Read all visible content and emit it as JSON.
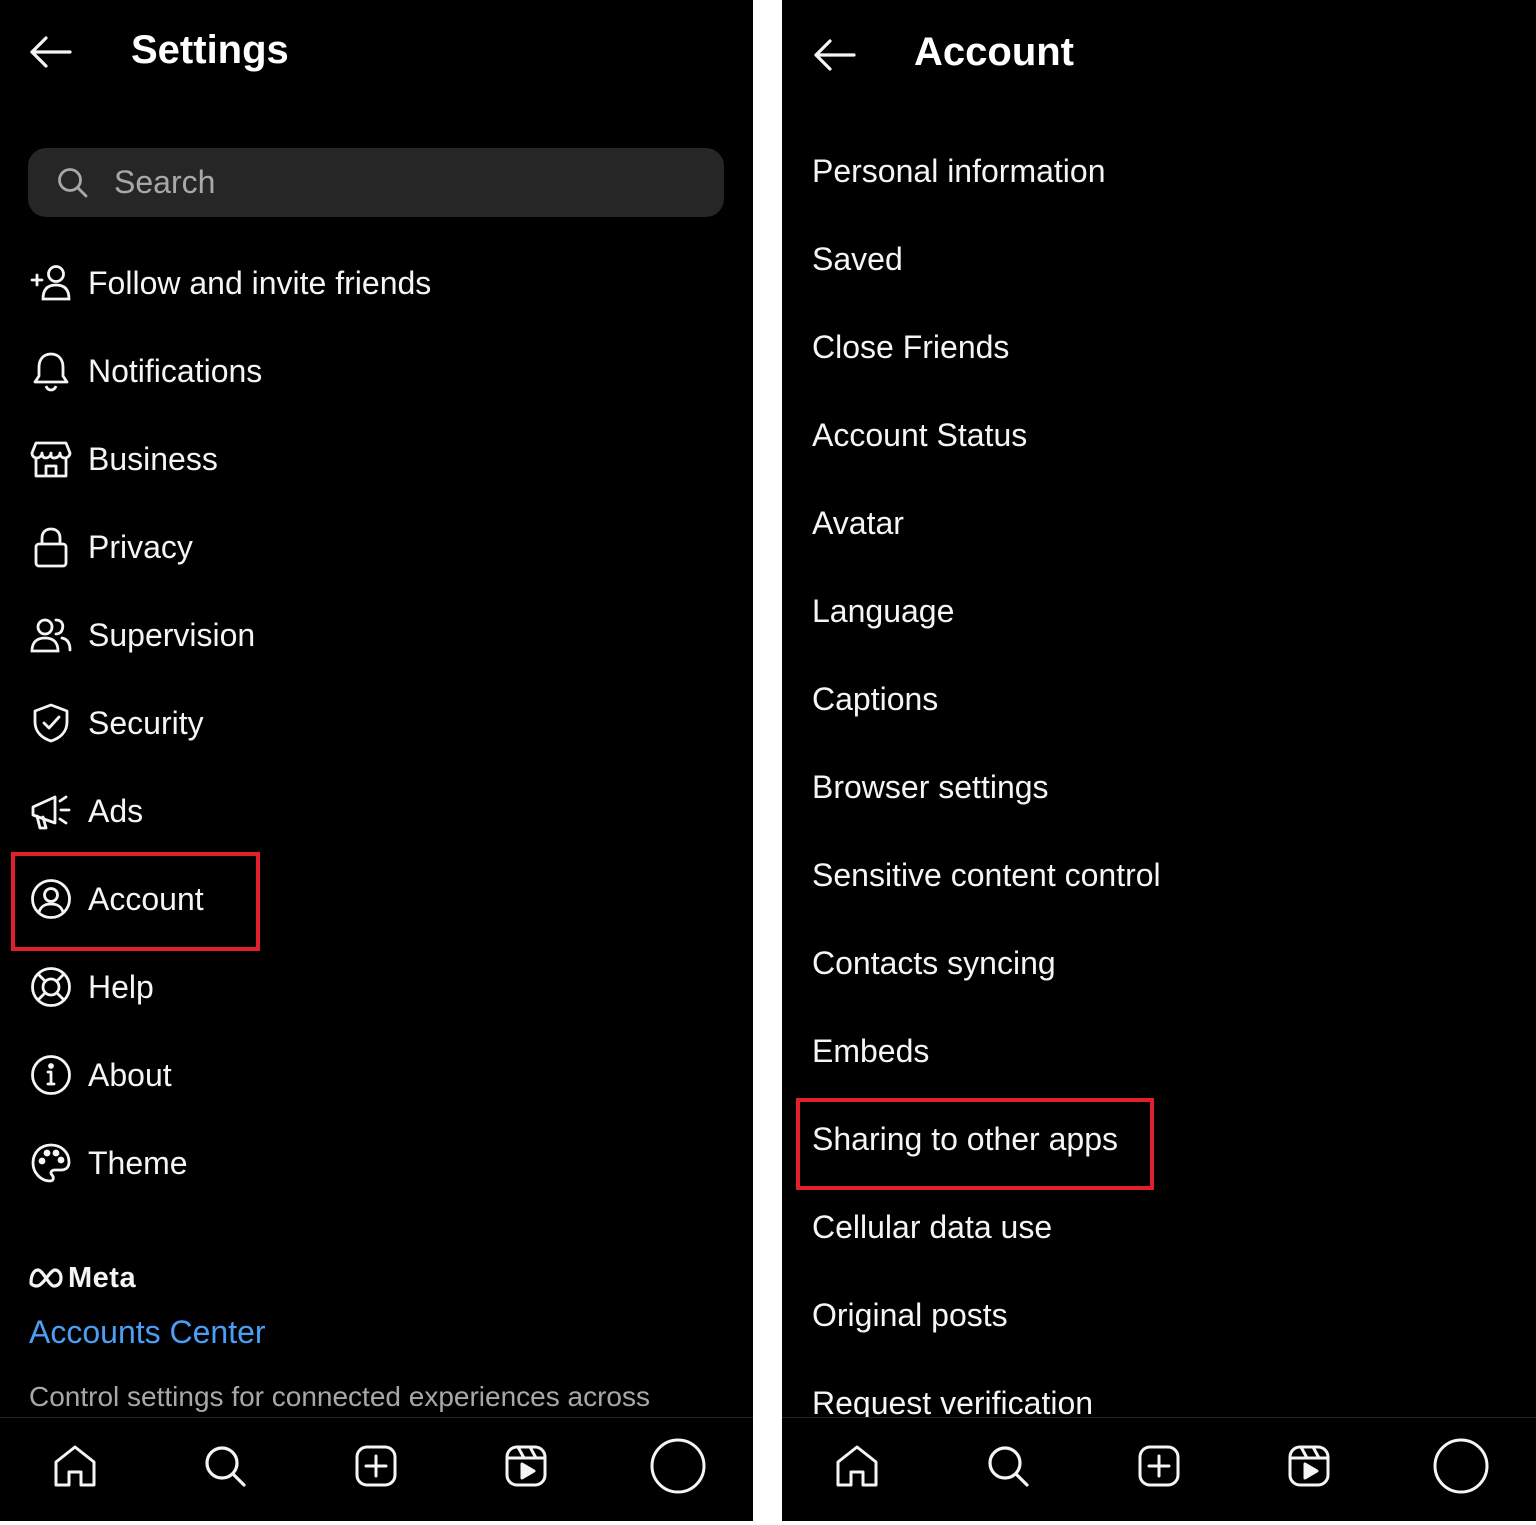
{
  "colors": {
    "background": "#000000",
    "text": "#f5f5f5",
    "search_bg": "#262626",
    "link": "#4a9ef6",
    "highlight": "#e0202a",
    "muted": "#a8a8a8"
  },
  "settings": {
    "title": "Settings",
    "back_icon": "arrow-left-icon",
    "search": {
      "placeholder": "Search",
      "icon": "search-icon"
    },
    "items": [
      {
        "label": "Follow and invite friends",
        "icon": "person-add-icon"
      },
      {
        "label": "Notifications",
        "icon": "bell-icon"
      },
      {
        "label": "Business",
        "icon": "storefront-icon"
      },
      {
        "label": "Privacy",
        "icon": "lock-icon"
      },
      {
        "label": "Supervision",
        "icon": "people-icon"
      },
      {
        "label": "Security",
        "icon": "shield-check-icon"
      },
      {
        "label": "Ads",
        "icon": "megaphone-icon"
      },
      {
        "label": "Account",
        "icon": "account-circle-icon",
        "highlighted": true
      },
      {
        "label": "Help",
        "icon": "lifebuoy-icon"
      },
      {
        "label": "About",
        "icon": "info-icon"
      },
      {
        "label": "Theme",
        "icon": "palette-icon"
      }
    ],
    "meta_logo": "Meta",
    "accounts_center": "Accounts Center",
    "accounts_center_desc": "Control settings for connected experiences across"
  },
  "account": {
    "title": "Account",
    "back_icon": "arrow-left-icon",
    "items": [
      {
        "label": "Personal information"
      },
      {
        "label": "Saved"
      },
      {
        "label": "Close Friends"
      },
      {
        "label": "Account Status"
      },
      {
        "label": "Avatar"
      },
      {
        "label": "Language"
      },
      {
        "label": "Captions"
      },
      {
        "label": "Browser settings"
      },
      {
        "label": "Sensitive content control"
      },
      {
        "label": "Contacts syncing"
      },
      {
        "label": "Embeds"
      },
      {
        "label": "Sharing to other apps",
        "highlighted": true
      },
      {
        "label": "Cellular data use"
      },
      {
        "label": "Original posts"
      },
      {
        "label": "Request verification"
      }
    ]
  },
  "bottom_nav": {
    "items": [
      {
        "name": "home",
        "icon": "home-icon"
      },
      {
        "name": "search",
        "icon": "search-icon"
      },
      {
        "name": "create",
        "icon": "plus-square-icon"
      },
      {
        "name": "reels",
        "icon": "reels-icon"
      },
      {
        "name": "profile",
        "icon": "profile-circle-icon"
      }
    ]
  }
}
